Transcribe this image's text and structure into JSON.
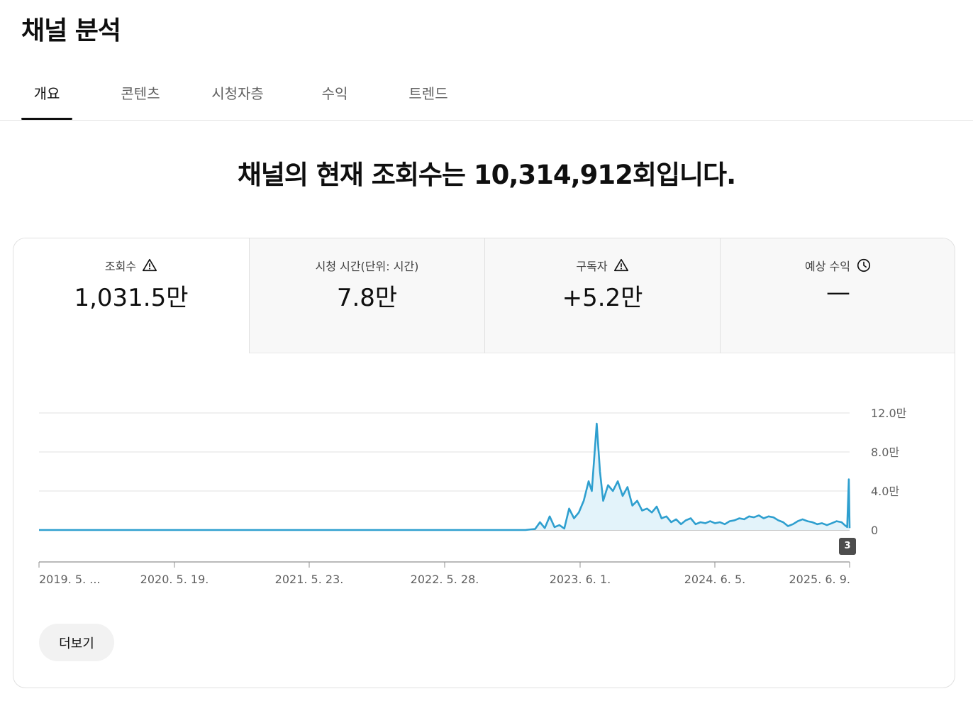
{
  "page": {
    "title": "채널 분석"
  },
  "tabs": [
    {
      "label": "개요",
      "active": true
    },
    {
      "label": "콘텐츠",
      "active": false
    },
    {
      "label": "시청자층",
      "active": false
    },
    {
      "label": "수익",
      "active": false
    },
    {
      "label": "트렌드",
      "active": false
    }
  ],
  "headline": "채널의 현재 조회수는 10,314,912회입니다.",
  "metrics": [
    {
      "label": "조회수",
      "icon": "warning-icon",
      "value": "1,031.5만",
      "active": true
    },
    {
      "label": "시청 시간(단위: 시간)",
      "icon": "",
      "value": "7.8만",
      "active": false
    },
    {
      "label": "구독자",
      "icon": "warning-icon",
      "value": "+5.2만",
      "active": false
    },
    {
      "label": "예상 수익",
      "icon": "clock-icon",
      "value": "—",
      "active": false
    }
  ],
  "chart_data": {
    "type": "area",
    "y_ticks": [
      "12.0만",
      "8.0만",
      "4.0만",
      "0"
    ],
    "y_tick_values": [
      120000,
      80000,
      40000,
      0
    ],
    "ylim": [
      0,
      120000
    ],
    "x_tick_labels": [
      "2019. 5. ...",
      "2020. 5. 19.",
      "2021. 5. 23.",
      "2022. 5. 28.",
      "2023. 6. 1.",
      "2024. 6. 5.",
      "2025. 6. 9."
    ],
    "series": [
      {
        "values": [
          [
            0,
            0
          ],
          [
            0.6,
            0
          ],
          [
            0.612,
            1000
          ],
          [
            0.618,
            8000
          ],
          [
            0.624,
            2000
          ],
          [
            0.63,
            14000
          ],
          [
            0.636,
            3000
          ],
          [
            0.642,
            5000
          ],
          [
            0.648,
            1500
          ],
          [
            0.654,
            22000
          ],
          [
            0.66,
            12000
          ],
          [
            0.666,
            18000
          ],
          [
            0.672,
            30000
          ],
          [
            0.678,
            50000
          ],
          [
            0.682,
            40000
          ],
          [
            0.688,
            109000
          ],
          [
            0.692,
            60000
          ],
          [
            0.696,
            30000
          ],
          [
            0.702,
            46000
          ],
          [
            0.708,
            40000
          ],
          [
            0.714,
            50000
          ],
          [
            0.72,
            35000
          ],
          [
            0.726,
            44000
          ],
          [
            0.732,
            25000
          ],
          [
            0.738,
            30000
          ],
          [
            0.744,
            20000
          ],
          [
            0.75,
            22000
          ],
          [
            0.756,
            18000
          ],
          [
            0.762,
            24000
          ],
          [
            0.768,
            12000
          ],
          [
            0.774,
            14000
          ],
          [
            0.78,
            8000
          ],
          [
            0.786,
            11000
          ],
          [
            0.792,
            6000
          ],
          [
            0.798,
            10000
          ],
          [
            0.804,
            12000
          ],
          [
            0.81,
            6000
          ],
          [
            0.816,
            8000
          ],
          [
            0.822,
            7000
          ],
          [
            0.828,
            9000
          ],
          [
            0.834,
            7000
          ],
          [
            0.84,
            8000
          ],
          [
            0.846,
            6000
          ],
          [
            0.852,
            9000
          ],
          [
            0.858,
            10000
          ],
          [
            0.864,
            12000
          ],
          [
            0.87,
            11000
          ],
          [
            0.876,
            14000
          ],
          [
            0.882,
            13000
          ],
          [
            0.888,
            15000
          ],
          [
            0.894,
            12000
          ],
          [
            0.9,
            14000
          ],
          [
            0.906,
            13000
          ],
          [
            0.912,
            10000
          ],
          [
            0.918,
            8000
          ],
          [
            0.924,
            4000
          ],
          [
            0.93,
            6000
          ],
          [
            0.936,
            9000
          ],
          [
            0.942,
            11000
          ],
          [
            0.948,
            9000
          ],
          [
            0.954,
            8000
          ],
          [
            0.96,
            6000
          ],
          [
            0.966,
            7000
          ],
          [
            0.972,
            5000
          ],
          [
            0.978,
            7000
          ],
          [
            0.984,
            9000
          ],
          [
            0.99,
            8000
          ],
          [
            0.994,
            5000
          ],
          [
            0.997,
            3000
          ],
          [
            0.999,
            52000
          ],
          [
            1,
            2000
          ]
        ]
      }
    ],
    "grid": true,
    "color": "#2e9fcf",
    "badge": "3"
  },
  "more_button": "더보기"
}
